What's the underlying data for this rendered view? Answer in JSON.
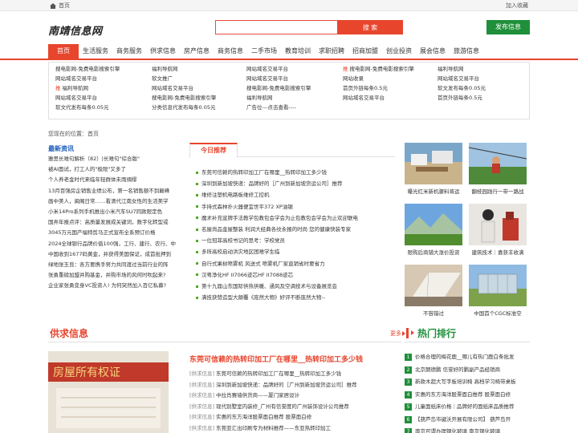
{
  "topbar": {
    "home": "首页",
    "favorite": "加入收藏"
  },
  "header": {
    "logo": "南靖信息网",
    "search_placeholder": "",
    "search_button": "搜 索",
    "publish_button": "发布信息"
  },
  "nav": [
    "首页",
    "生活服务",
    "商务服务",
    "供求信息",
    "房产信息",
    "商务信息",
    "二手市场",
    "教育培训",
    "求职招聘",
    "招商加盟",
    "创业投资",
    "展会信息",
    "旅游信息"
  ],
  "links": [
    {
      "text": "搜电影网-免费电影搜索引擎"
    },
    {
      "text": "福利导航网"
    },
    {
      "text": "网站域名交易平台"
    },
    {
      "tag": "推",
      "text": "搜电影网-免费电影搜索引擎"
    },
    {
      "text": "福利导航网"
    },
    {
      "text": "网站域名交易平台"
    },
    {
      "text": "软文推广"
    },
    {
      "text": "网站域名交易平台"
    },
    {
      "text": "网站收录"
    },
    {
      "text": "网站域名交易平台"
    },
    {
      "tag": "推",
      "text": "福利导航网"
    },
    {
      "text": "网站域名交易平台"
    },
    {
      "text": "搜电影网-免费电影搜索引擎"
    },
    {
      "text": "首页外链每条0.5元"
    },
    {
      "text": "软文发布每条0.05元"
    },
    {
      "text": "网站域名交易平台"
    },
    {
      "text": "搜电影网-免费电影搜索引擎"
    },
    {
      "text": "福利导航网"
    },
    {
      "text": "网站域名交易平台"
    },
    {
      "text": "首页外链每条0.5元"
    },
    {
      "text": "软文代发布每条0.05元"
    },
    {
      "text": "分类信息代发布每条0.05元"
    },
    {
      "text": "广告位---点击查看----",
      "gray": true
    }
  ],
  "breadcrumb": "您现在的位置：首页",
  "latest": {
    "title": "最新资讯",
    "items": [
      "雅思长难句解析（82）|长难句\"综合版\"",
      "被AI面试，打工人的\"极限\"又多了",
      "个人养老金时代来临年轻群体未雨绸缪",
      "13月百强房企销售业绩公布，第一名销售额不到巅峰",
      "画中美人，闽阁日常……看清代江南女性的生活美学",
      "小米14Pro系列手机推出小米汽车SU7同款限定色",
      "国弄年报点评：高质量发展成关键词，数字化转型或",
      "3045万元国产福特剪马正式宣布全系预订价格",
      "2024全球银行品牌价值100强，工行、建行、农行、中",
      "中国收到1677码黄金，并获得美国保证，成首批押到",
      "绿地张玉良：各方要携手努力共同渡过当前行业的阵",
      "张勇重磅加盟并购基金，并购市场的风何时吹起来?",
      "企业家张勇变身VC投资人! 为何突然加入百亿私募?"
    ]
  },
  "today": {
    "tab": "今日推荐",
    "items": [
      "东莞可信赖的热转印加工厂在哪里__热转印加工多少钱",
      "深圳到新加坡快递：品牌好的［广州到新加坡货运公司］推荐",
      "维修注塑机电路板维修工控机",
      "手持式森林扑火器便宜世平372 XP油锯",
      "魔术补充宣牌手法教学包教包会学会为止包教包会学会为止欢迎联电",
      "名屋尚品金屋整装 利润大经典各纹永报的时尚 您的健康快装专家",
      "一位冠菲高校书记的思考：学校党员",
      "多所高校启动洪灾地区困难学生临",
      "自行式果树喷雾机 风送式 喷雾机厂家直销省时要省力",
      "汉粤净化HF II7066迹芯HF II7088迹芯",
      "第十九届山东国际供热供暖、通风及空调技术与设备展览会",
      "满技获赞造型大颠覆《庞然大物》好评不断庞然大物--"
    ]
  },
  "gallery": [
    {
      "caption": "曝光红米新机骤料将运"
    },
    {
      "caption": "翻枝园践行一带一路战"
    },
    {
      "caption": "限购后商铺大涨价投资"
    },
    {
      "caption": "建筑技术｜喜获丰收满"
    },
    {
      "caption": "不容错过"
    },
    {
      "caption": "中国首个CGC标准空"
    }
  ],
  "supply": {
    "title": "供求信息",
    "more": "更多",
    "featured": "东莞可信赖的热转印加工厂在哪里__热转印加工多少钱",
    "items": [
      {
        "cat": "[供求信息]",
        "text": "东莞可信赖的热转印加工厂在哪里__热转印加工多少钱"
      },
      {
        "cat": "[供求信息]",
        "text": "深圳到新加坡快递：品牌好的［广州到新加坡货运公司］推荐"
      },
      {
        "cat": "[供求信息]",
        "text": "中拉肖赛墙供货商——厦门家居设计"
      },
      {
        "cat": "[供求信息]",
        "text": "现代别墅室内装修_广州有信誉度的广州装饰设计公司推荐"
      },
      {
        "cat": "[供求信息]",
        "text": "实惠的东方海洋股票面白推荐  股票面白修"
      },
      {
        "cat": "[供求信息]",
        "text": "东莞亚汇出印刷专为材料推荐——东亚热转印加工"
      }
    ]
  },
  "hot": {
    "title": "热门排行",
    "items": [
      "价格合理的梅花鹿__哪儿有热门鹿白条批发",
      "北京朗德鹏  信誉好的鹏副产品经销商",
      "新款木超大写字板培训椅 高档学习椅带桌板",
      "实惠的东方海洋股票面白推荐  股票面白修",
      "儿童面纸床价格｜品牌好的面纸床品质推荐",
      "【葫芦岛市键沃开展有限公司】  葫芦岛开",
      "南京可谓办理钢化玻璃  南京钢化玻璃"
    ]
  }
}
